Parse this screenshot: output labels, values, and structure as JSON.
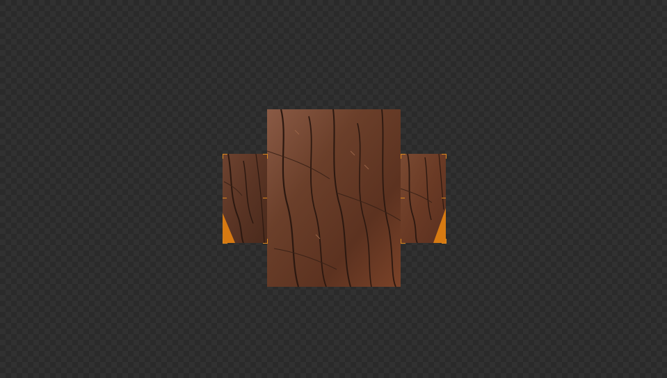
{
  "colors": {
    "background_dark": "#2a2a2a",
    "background_light": "#313131",
    "selection_orange": "#e08a1e",
    "bark_dark": "#3a2217",
    "bark_mid": "#6b3f2a",
    "bark_light": "#9a6548",
    "uv_fill_orange": "#d77a12"
  },
  "canvas": {
    "content": "cubemap-texture-preview",
    "faces": [
      "left",
      "center",
      "right"
    ],
    "texture": "bark-texture"
  }
}
